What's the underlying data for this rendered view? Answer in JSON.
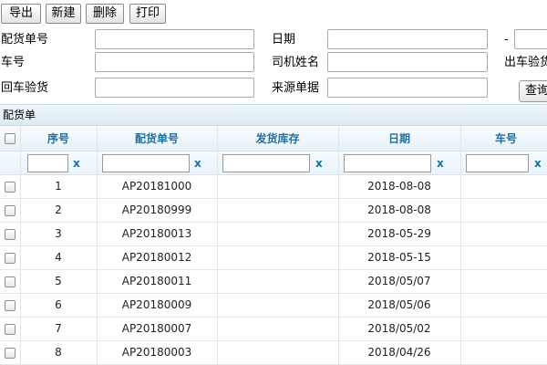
{
  "toolbar": {
    "export_label": "导出",
    "new_label": "新建",
    "delete_label": "删除",
    "print_label": "打印"
  },
  "form": {
    "order_no_label": "配货单号",
    "date_label": "日期",
    "date_separator": "-",
    "truck_no_label": "车号",
    "driver_label": "司机姓名",
    "outbound_check_label": "出车验货",
    "return_check_label": "回车验货",
    "source_doc_label": "来源单据",
    "query_label": "查询"
  },
  "panel": {
    "title": "配货单"
  },
  "grid": {
    "columns": [
      "序号",
      "配货单号",
      "发货库存",
      "日期",
      "车号"
    ],
    "clear_label": "x",
    "rows": [
      {
        "seq": "1",
        "order_no": "AP20181000",
        "warehouse": "",
        "date": "2018-08-08",
        "truck": ""
      },
      {
        "seq": "2",
        "order_no": "AP20180999",
        "warehouse": "",
        "date": "2018-08-08",
        "truck": ""
      },
      {
        "seq": "3",
        "order_no": "AP20180013",
        "warehouse": "",
        "date": "2018-05-29",
        "truck": ""
      },
      {
        "seq": "4",
        "order_no": "AP20180012",
        "warehouse": "",
        "date": "2018-05-15",
        "truck": ""
      },
      {
        "seq": "5",
        "order_no": "AP20180011",
        "warehouse": "",
        "date": "2018/05/07",
        "truck": ""
      },
      {
        "seq": "6",
        "order_no": "AP20180009",
        "warehouse": "",
        "date": "2018/05/06",
        "truck": ""
      },
      {
        "seq": "7",
        "order_no": "AP20180007",
        "warehouse": "",
        "date": "2018/05/02",
        "truck": ""
      },
      {
        "seq": "8",
        "order_no": "AP20180003",
        "warehouse": "",
        "date": "2018/04/26",
        "truck": ""
      }
    ]
  }
}
